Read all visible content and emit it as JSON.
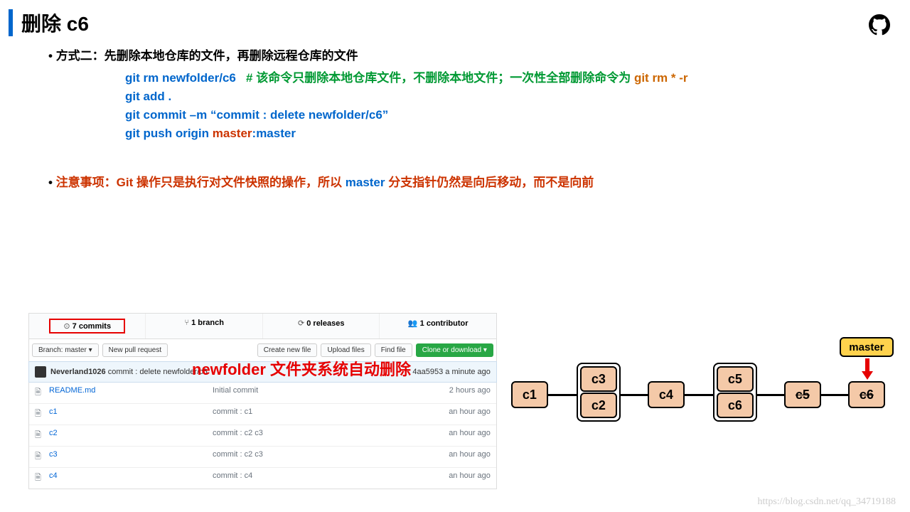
{
  "title": "删除 c6",
  "method2_label": "方式二：先删除本地仓库的文件，再删除远程仓库的文件",
  "cmd1_git": "git rm newfolder/c6",
  "cmd1_comment_a": "# 该命令只删除本地仓库文件，不删除本地文件；一次性全部删除命令为 ",
  "cmd1_comment_b": "git rm * -r",
  "cmd2": "git add .",
  "cmd3": "git commit –m “commit : delete newfolder/c6”",
  "cmd4_a": "git push origin ",
  "cmd4_master": "master",
  "cmd4_b": ":master",
  "note_a": "注意事项：Git 操作只是执行对文件快照的操作，所以 ",
  "note_master": "master",
  "note_b": " 分支指针仍然是向后移动，而不是向前",
  "gh": {
    "commits": "7 commits",
    "branch": "1 branch",
    "releases": "0 releases",
    "contributor": "1 contributor",
    "branch_btn": "Branch: master ▾",
    "newpr": "New pull request",
    "create": "Create new file",
    "upload": "Upload files",
    "find": "Find file",
    "clone": "Clone or download ▾",
    "user": "Neverland1026",
    "commit_msg": "commit : delete newfolder/c6",
    "commit_hash": "4aa5953",
    "commit_time": "a minute ago",
    "overlay": "newfolder 文件夹系统自动删除",
    "files": [
      {
        "name": "README.md",
        "msg": "Initial commit",
        "time": "2 hours ago",
        "icon": "🗎"
      },
      {
        "name": "c1",
        "msg": "commit : c1",
        "time": "an hour ago",
        "icon": "🗎"
      },
      {
        "name": "c2",
        "msg": "commit : c2 c3",
        "time": "an hour ago",
        "icon": "🗎"
      },
      {
        "name": "c3",
        "msg": "commit : c2 c3",
        "time": "an hour ago",
        "icon": "🗎"
      },
      {
        "name": "c4",
        "msg": "commit : c4",
        "time": "an hour ago",
        "icon": "🗎"
      }
    ]
  },
  "diagram": {
    "c1": "c1",
    "c2": "c2",
    "c3": "c3",
    "c4": "c4",
    "c5": "c5",
    "c6": "c6",
    "master": "master"
  },
  "watermark": "https://blog.csdn.net/qq_34719188"
}
